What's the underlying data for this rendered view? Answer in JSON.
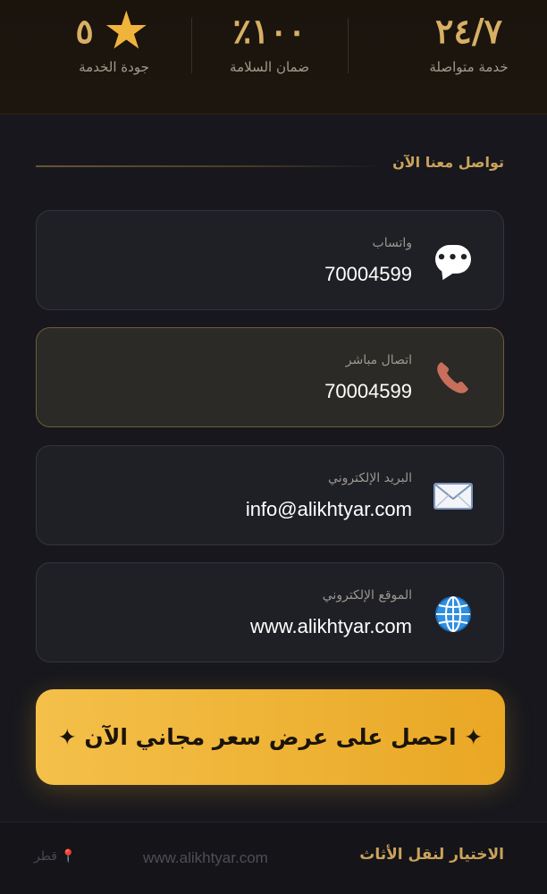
{
  "stats": [
    {
      "value": "٢٤/٧",
      "label": "خدمة متواصلة"
    },
    {
      "value": "٪١٠٠",
      "label": "ضمان السلامة"
    },
    {
      "value": "٥",
      "label": "جودة الخدمة",
      "icon": "star-icon"
    }
  ],
  "contact": {
    "title": "تواصل معنا الآن",
    "items": [
      {
        "label": "واتساب",
        "value": "70004599",
        "icon": "whatsapp-bubble-icon"
      },
      {
        "label": "اتصال مباشر",
        "value": "70004599",
        "icon": "phone-icon"
      },
      {
        "label": "البريد الإلكتروني",
        "value": "info@alikhtyar.com",
        "icon": "envelope-icon"
      },
      {
        "label": "الموقع الإلكتروني",
        "value": "www.alikhtyar.com",
        "icon": "globe-icon"
      }
    ]
  },
  "cta": {
    "label": "✦ احصل على عرض سعر مجاني الآن ✦"
  },
  "footer": {
    "brand": "الاختيار لنقل الأثاث",
    "website": "www.alikhtyar.com",
    "location": "قطر"
  },
  "colors": {
    "accent": "#caa35a",
    "cta": "#f0b43c",
    "background": "#18181e"
  }
}
